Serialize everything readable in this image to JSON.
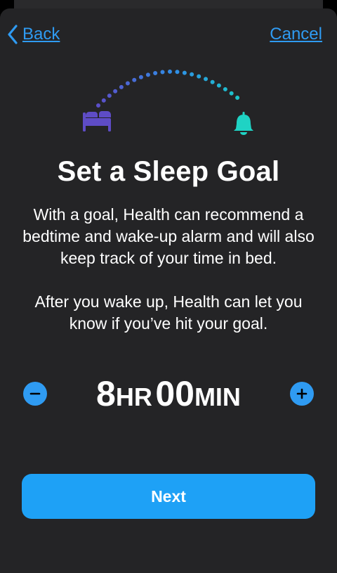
{
  "nav": {
    "back_label": "Back",
    "cancel_label": "Cancel"
  },
  "hero": {
    "bed_icon": "bed-icon",
    "bell_icon": "alarm-bell-icon"
  },
  "title": "Set a Sleep Goal",
  "description": {
    "paragraph_1": "With a goal, Health can recommend a bedtime and wake-up alarm and will also keep track of your time in bed.",
    "paragraph_2": "After you wake up, Health can let you know if you’ve hit your goal."
  },
  "goal": {
    "hours": "8",
    "hours_unit": "HR",
    "minutes": "00",
    "minutes_unit": "MIN",
    "decrease_icon": "minus-icon",
    "increase_icon": "plus-icon"
  },
  "next_label": "Next",
  "colors": {
    "accent": "#2f9bf2",
    "button": "#1ea1f6",
    "background": "#242426",
    "bed": "#5e4cc6",
    "bell": "#1fd3c4"
  }
}
